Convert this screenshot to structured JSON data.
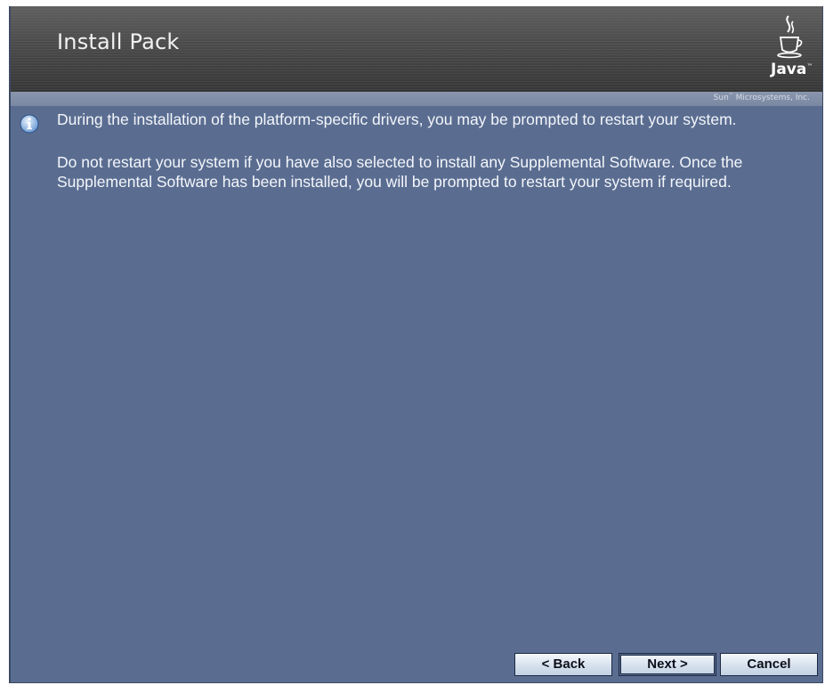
{
  "window": {
    "title": "Install Pack",
    "logo_text": "Java",
    "logo_tm": "™",
    "vendor": "Sun",
    "vendor_tm": "™",
    "vendor_suffix": " Microsystems, Inc."
  },
  "content": {
    "icon": "info-icon",
    "message_1": "During the installation of the platform-specific drivers, you may be prompted to restart your system.",
    "message_2_line_1": "Do not restart your system if you have also selected to install any Supplemental Software. Once the",
    "message_2_line_2": "Supplemental Software has been installed, you will be prompted to restart your system if required."
  },
  "buttons": {
    "back": "< Back",
    "next": "Next >",
    "cancel": "Cancel"
  },
  "colors": {
    "background": "#5a6d91",
    "header": "#4a4a4a",
    "text": "#f4f6fa"
  }
}
